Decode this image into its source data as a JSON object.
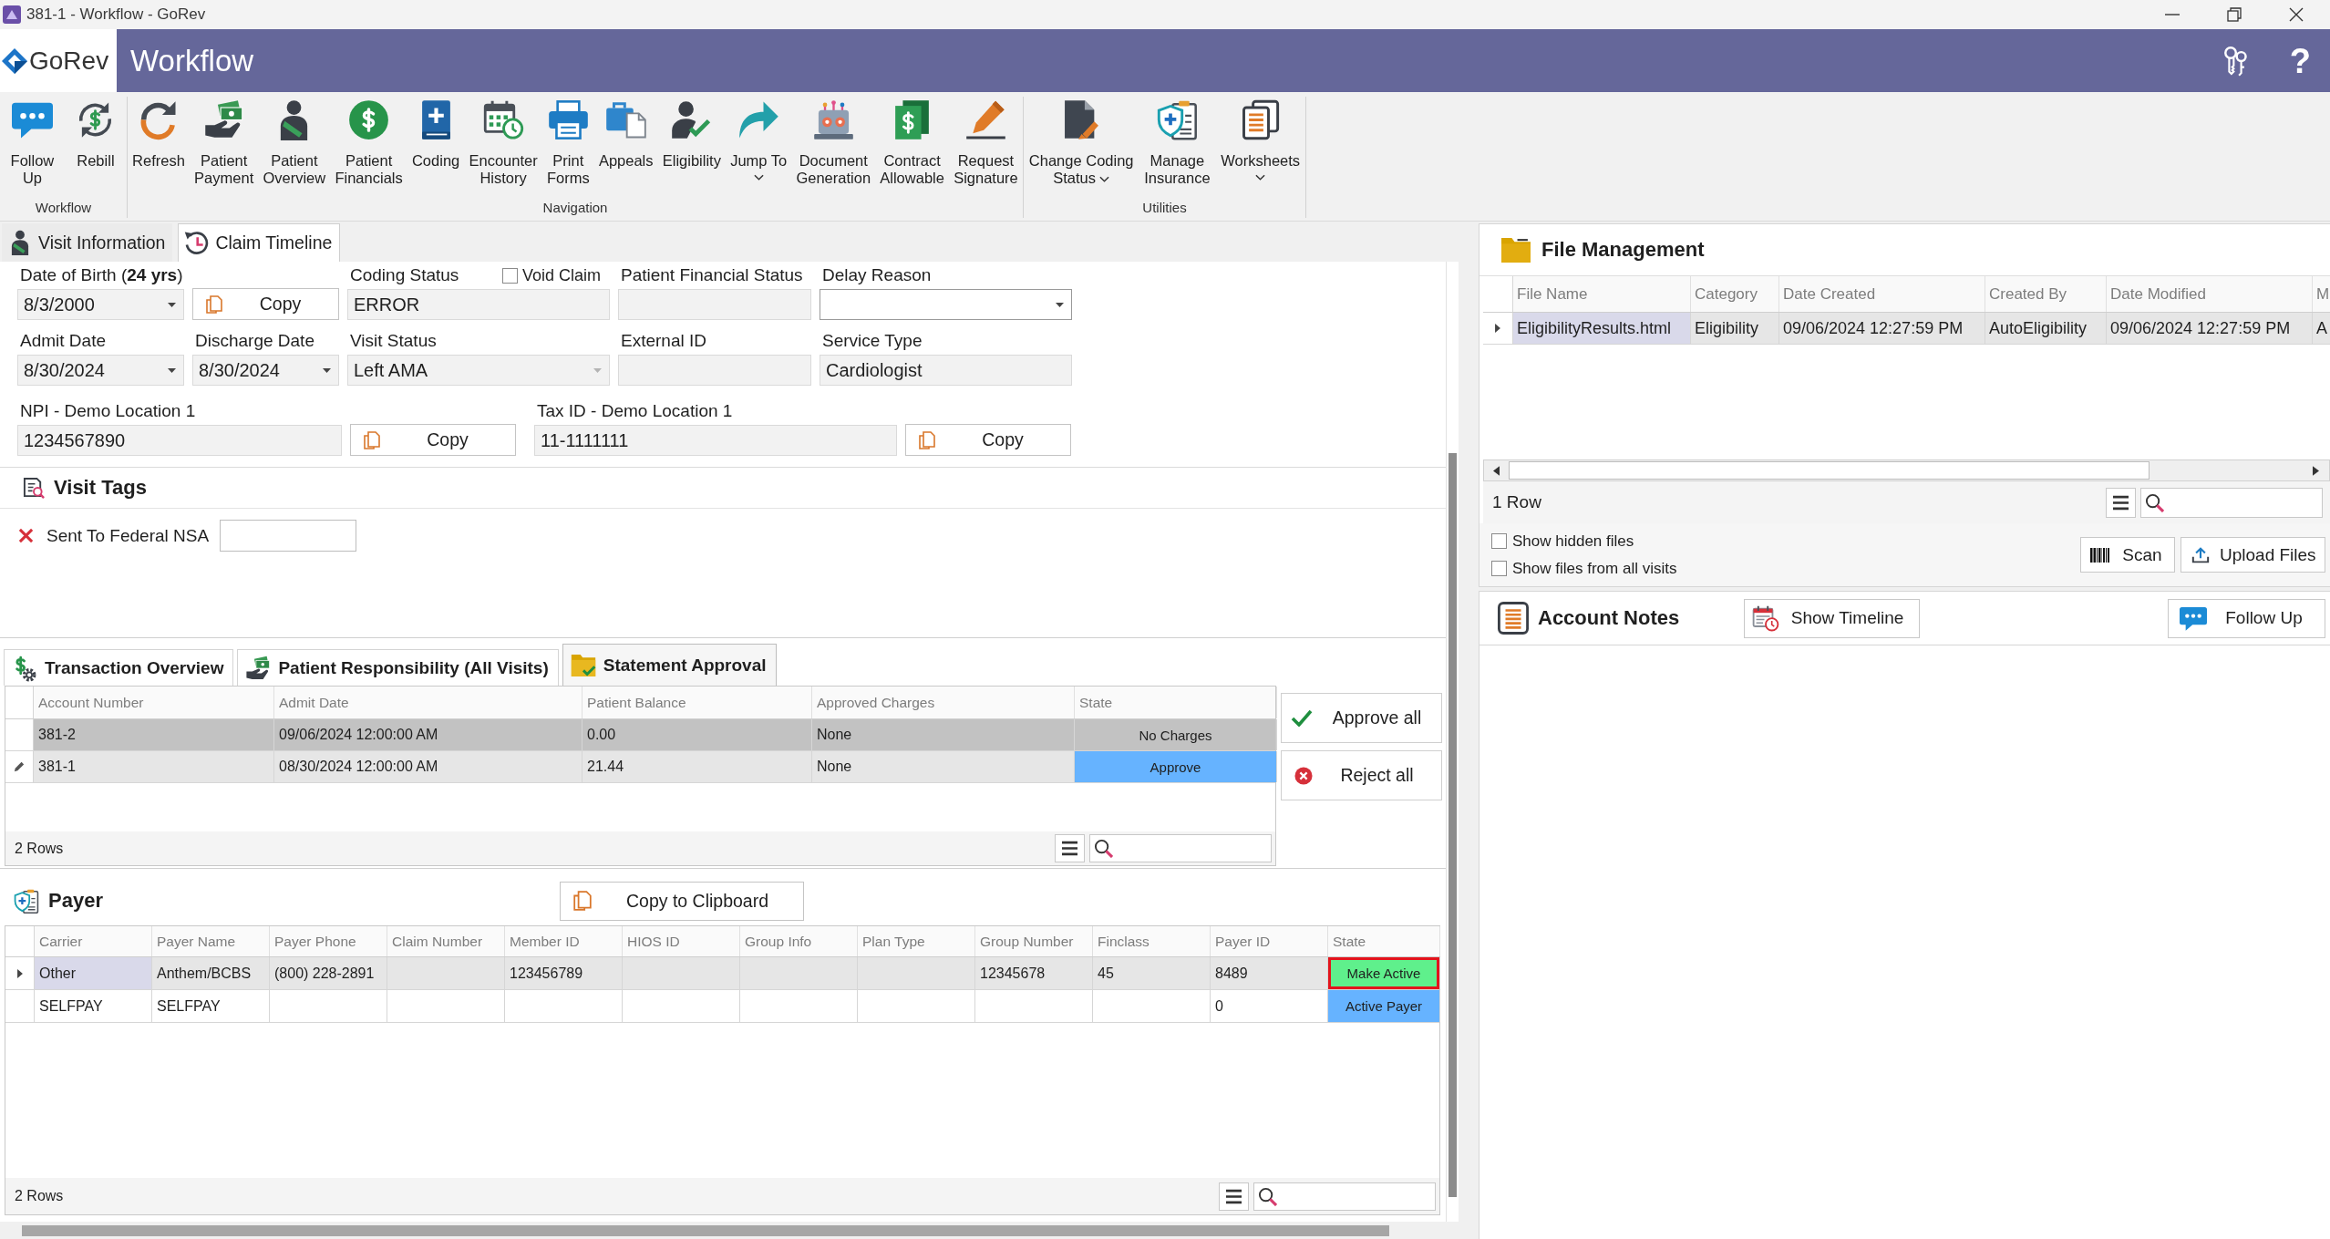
{
  "window": {
    "title": "381-1 - Workflow - GoRev"
  },
  "header": {
    "logo": "GoRev",
    "title": "Workflow",
    "help": "?"
  },
  "ribbon": {
    "groups": [
      {
        "label": "Workflow",
        "items": [
          {
            "label": "Follow\nUp",
            "dropdown": false
          },
          {
            "label": "Rebill",
            "dropdown": false
          }
        ]
      },
      {
        "label": "Navigation",
        "items": [
          {
            "label": "Refresh",
            "dropdown": false
          },
          {
            "label": "Patient\nPayment",
            "dropdown": false
          },
          {
            "label": "Patient\nOverview",
            "dropdown": false
          },
          {
            "label": "Patient\nFinancials",
            "dropdown": false
          },
          {
            "label": "Coding",
            "dropdown": false
          },
          {
            "label": "Encounter\nHistory",
            "dropdown": false
          },
          {
            "label": "Print\nForms",
            "dropdown": false
          },
          {
            "label": "Appeals",
            "dropdown": false
          },
          {
            "label": "Eligibility",
            "dropdown": false
          },
          {
            "label": "Jump To",
            "dropdown": true
          },
          {
            "label": "Document\nGeneration",
            "dropdown": false
          },
          {
            "label": "Contract\nAllowable",
            "dropdown": false
          },
          {
            "label": "Request\nSignature",
            "dropdown": false
          }
        ]
      },
      {
        "label": "Utilities",
        "items": [
          {
            "label": "Change Coding\nStatus",
            "dropdown": true
          },
          {
            "label": "Manage\nInsurance",
            "dropdown": false
          },
          {
            "label": "Worksheets",
            "dropdown": true
          }
        ]
      }
    ]
  },
  "visit_tabs": [
    {
      "label": "Visit Information",
      "selected": true
    },
    {
      "label": "Claim Timeline",
      "selected": false
    }
  ],
  "visit_form": {
    "rows": [
      [
        {
          "kind": "dropdown",
          "label": "Date of Birth (**24 yrs**)",
          "value": "8/3/2000",
          "readonly": true,
          "disabled": false
        },
        {
          "kind": "copy",
          "label": "Copy"
        },
        {
          "kind": "text",
          "label": "Coding Status",
          "value": "ERROR",
          "readonly": true,
          "checkbox": {
            "label": "Void Claim",
            "checked": false
          }
        },
        {
          "kind": "text",
          "label": "Patient Financial Status",
          "readonly": true
        },
        {
          "kind": "dropdown",
          "label": "Delay Reason",
          "readonly": false,
          "disabled": false
        }
      ],
      [
        {
          "kind": "dropdown",
          "label": "Admit Date",
          "value": "8/30/2024",
          "readonly": true,
          "disabled": false
        },
        {
          "kind": "dropdown",
          "label": "Discharge Date",
          "value": "8/30/2024",
          "readonly": true,
          "disabled": false
        },
        {
          "kind": "dropdown",
          "label": "Visit Status",
          "value": "Left AMA",
          "readonly": true,
          "disabled": true
        },
        {
          "kind": "text",
          "label": "External ID",
          "readonly": true
        },
        {
          "kind": "text",
          "label": "Service Type",
          "value": "Cardiologist",
          "readonly": true
        }
      ],
      [
        {
          "kind": "text",
          "label": "NPI - Demo Location 1",
          "value": "1234567890",
          "readonly": true
        },
        {
          "kind": "copy",
          "label": "Copy"
        },
        {
          "kind": "text",
          "label": "Tax ID - Demo Location 1",
          "value": "11-1111111",
          "readonly": true
        },
        {
          "kind": "copy",
          "label": "Copy"
        }
      ]
    ]
  },
  "visit_tags": {
    "title": "Visit Tags",
    "tags": [
      {
        "label": "Sent To Federal NSA",
        "checked": false
      }
    ]
  },
  "statement_tabs": [
    {
      "label": "Transaction Overview",
      "selected": false
    },
    {
      "label": "Patient Responsibility (All Visits)",
      "selected": false
    },
    {
      "label": "Statement Approval",
      "selected": true
    }
  ],
  "statement": {
    "columns": [
      "Account Number",
      "Admit Date",
      "Patient Balance",
      "Approved Charges",
      "State"
    ],
    "rows": [
      {
        "selected": false,
        "disabled": true,
        "cells": [
          "381-2",
          "09/06/2024 12:00:00 AM",
          "0.00",
          "None"
        ],
        "state": {
          "label": "No Charges",
          "kind": "none",
          "highlighted": false
        }
      },
      {
        "selected": true,
        "disabled": false,
        "cells": [
          "381-1",
          "08/30/2024 12:00:00 AM",
          "21.44",
          "None"
        ],
        "state": {
          "label": "Approve",
          "kind": "approve",
          "highlighted": false
        }
      }
    ],
    "row_count": "2 Rows",
    "actions": [
      "Approve all",
      "Reject all"
    ]
  },
  "payer": {
    "title": "Payer",
    "copy_button": "Copy to Clipboard",
    "columns": [
      "Carrier",
      "Payer Name",
      "Payer Phone",
      "Claim Number",
      "Member ID",
      "HIOS ID",
      "Group Info",
      "Plan Type",
      "Group Number",
      "Finclass",
      "Payer ID",
      "State"
    ],
    "rows": [
      {
        "selected": true,
        "cells": [
          "Other",
          "Anthem/BCBS",
          "(800) 228-2891",
          null,
          "123456789",
          null,
          null,
          null,
          "12345678",
          "45",
          "8489"
        ],
        "state": {
          "label": "Make Active",
          "kind": "make_active",
          "highlighted": true
        }
      },
      {
        "selected": false,
        "cells": [
          "SELFPAY",
          "SELFPAY",
          null,
          null,
          null,
          null,
          null,
          null,
          null,
          null,
          "0"
        ],
        "state": {
          "label": "Active Payer",
          "kind": "active",
          "highlighted": false
        }
      }
    ],
    "row_count": "2 Rows"
  },
  "files": {
    "title": "File Management",
    "columns": [
      "File Name",
      "Category",
      "Date Created",
      "Created By",
      "Date Modified",
      "M"
    ],
    "rows": [
      {
        "selected": true,
        "cells": [
          "EligibilityResults.html",
          "Eligibility",
          "09/06/2024 12:27:59 PM",
          "AutoEligibility",
          "09/06/2024 12:27:59 PM",
          "A"
        ]
      }
    ],
    "row_count": "1 Row",
    "options": [
      {
        "label": "Show hidden files",
        "checked": false
      },
      {
        "label": "Show files from all visits",
        "checked": false
      }
    ],
    "buttons": [
      "Scan",
      "Upload Files"
    ]
  },
  "account_notes": {
    "title": "Account Notes",
    "buttons": [
      "Show Timeline",
      "Follow Up"
    ]
  }
}
